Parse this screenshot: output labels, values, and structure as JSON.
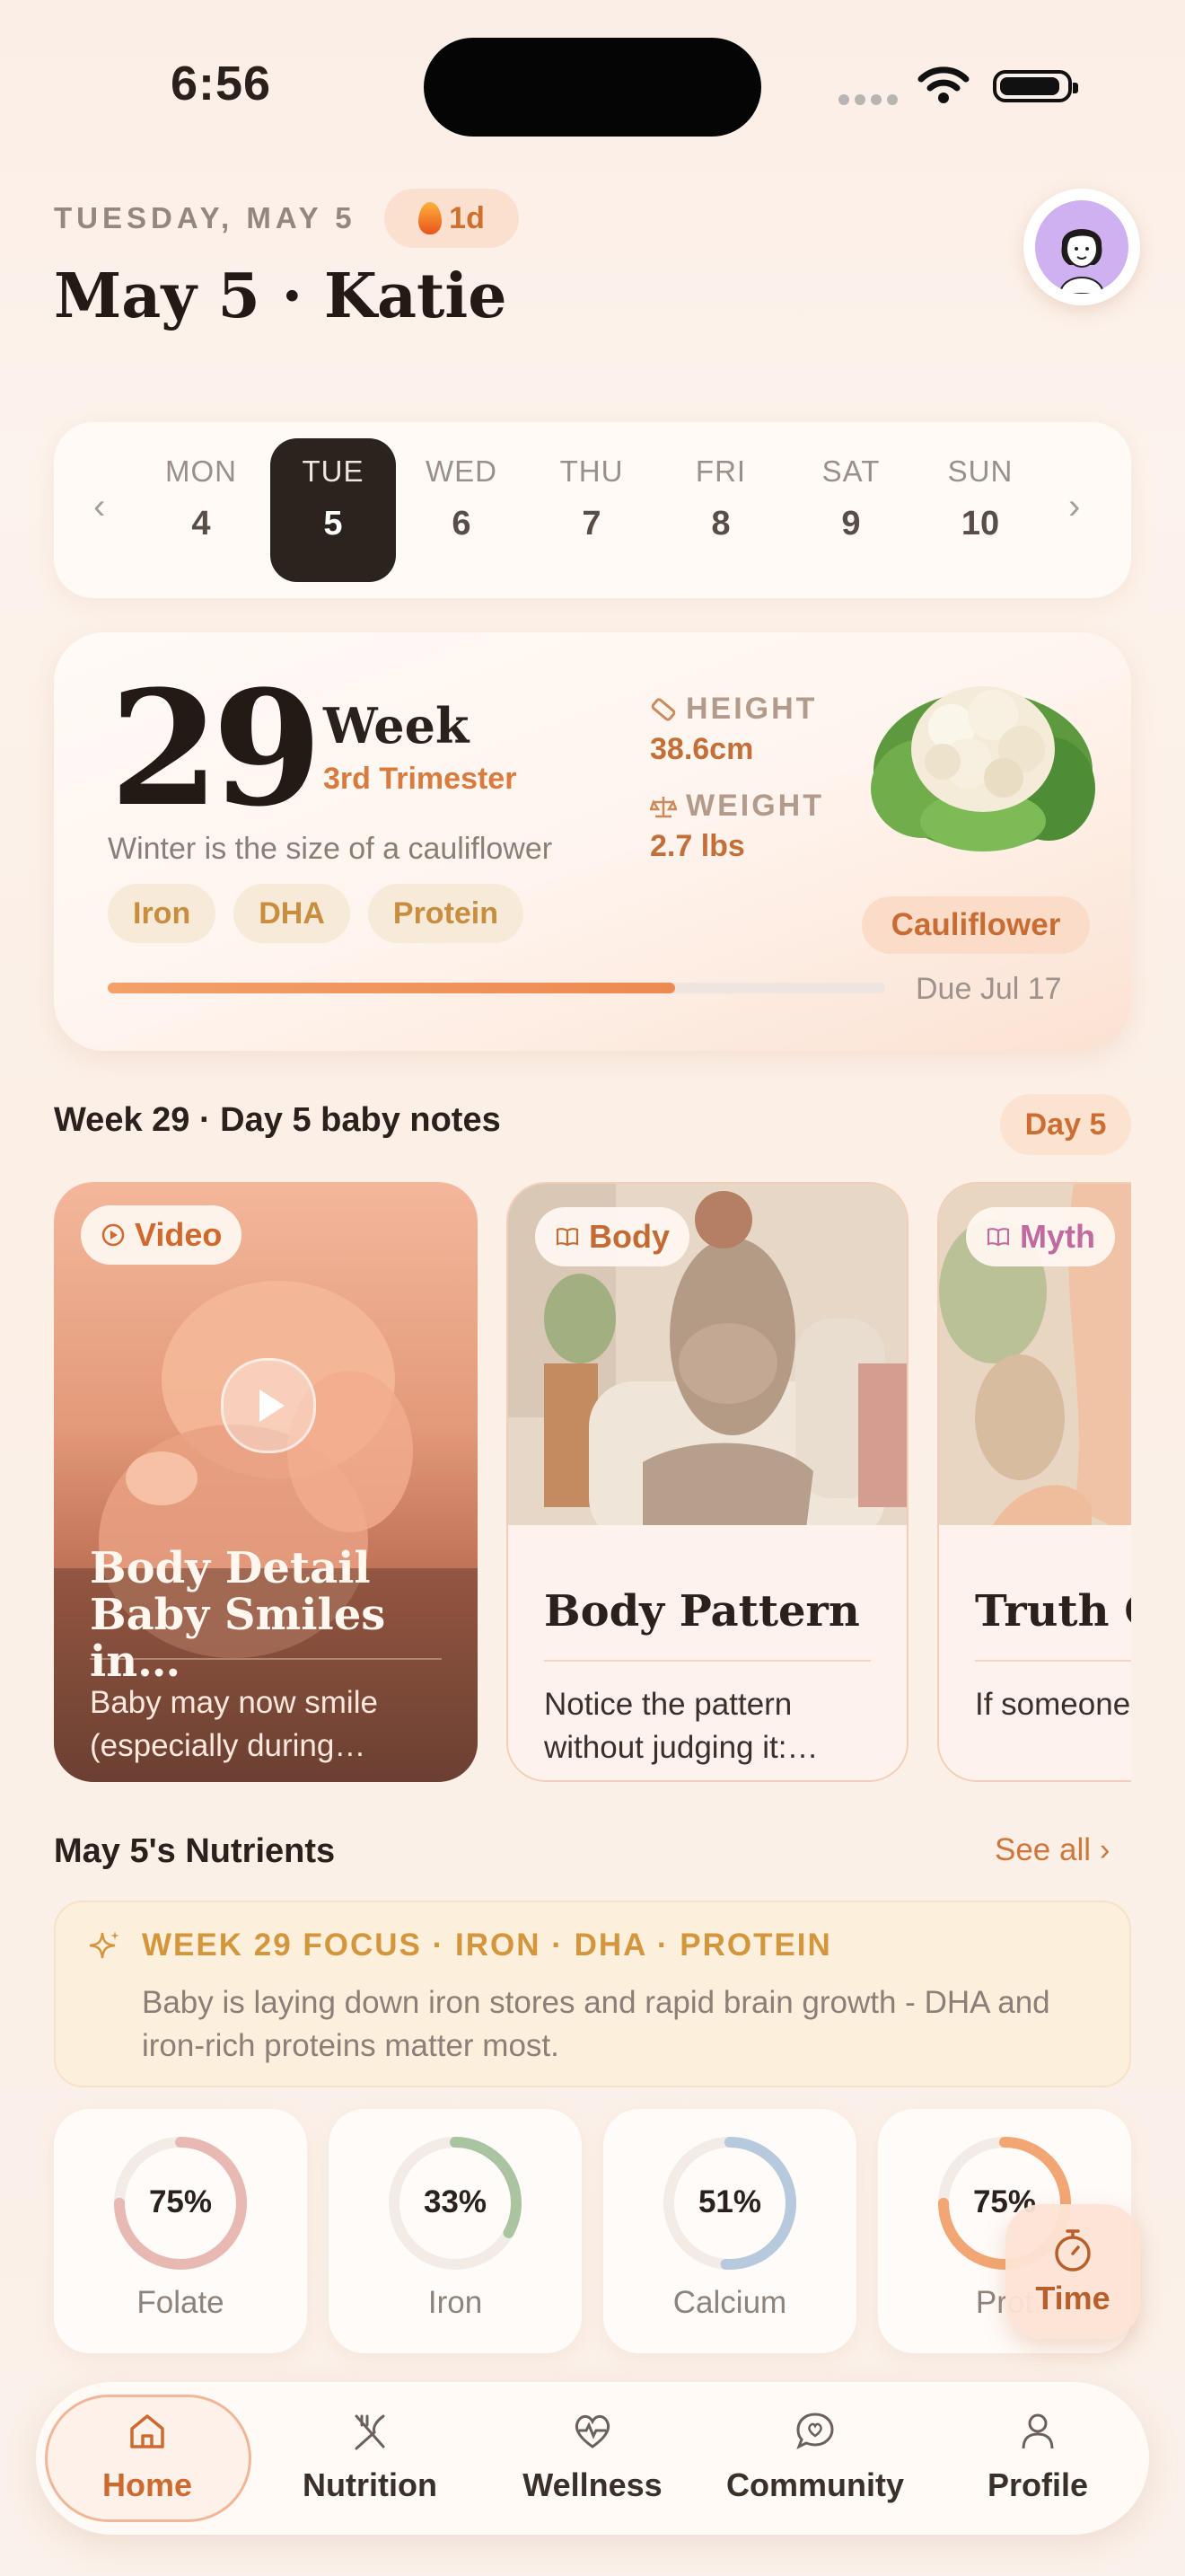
{
  "status_bar": {
    "time": "6:56"
  },
  "header": {
    "date": "TUESDAY, MAY 5",
    "streak": "1d",
    "title": "May 5 · Katie"
  },
  "week_strip": {
    "days": [
      {
        "name": "MON",
        "num": "4"
      },
      {
        "name": "TUE",
        "num": "5",
        "selected": true
      },
      {
        "name": "WED",
        "num": "6"
      },
      {
        "name": "THU",
        "num": "7"
      },
      {
        "name": "FRI",
        "num": "8"
      },
      {
        "name": "SAT",
        "num": "9"
      },
      {
        "name": "SUN",
        "num": "10"
      }
    ]
  },
  "pregnancy": {
    "week_number": "29",
    "week_label": "Week",
    "trimester": "3rd Trimester",
    "size_text": "Winter is the size of a cauliflower",
    "chips": [
      "Iron",
      "DHA",
      "Protein"
    ],
    "height_label": "HEIGHT",
    "height_value": "38.6cm",
    "weight_label": "WEIGHT",
    "weight_value": "2.7 lbs",
    "fruit": "Cauliflower",
    "progress": 0.73,
    "due": "Due Jul 17"
  },
  "baby_notes": {
    "heading": "Week 29 · Day 5 baby notes",
    "day_pill": "Day 5",
    "cards": [
      {
        "tag": "Video",
        "title": "Body Detail Baby Smiles in…",
        "text": "Baby may now smile (especially during…"
      },
      {
        "tag": "Body",
        "title": "Body Pattern",
        "text": "Notice the pattern without judging it:…"
      },
      {
        "tag": "Myth",
        "title": "Truth C",
        "text": "If someone the myth, t"
      }
    ]
  },
  "nutrients": {
    "heading": "May 5's Nutrients",
    "see_all": "See all",
    "focus_title": "WEEK 29 FOCUS · IRON · DHA · PROTEIN",
    "focus_text": "Baby is laying down iron stores and rapid brain growth - DHA and iron-rich proteins matter most.",
    "items": [
      {
        "pct": "75%",
        "label": "Folate",
        "value": 0.75,
        "color": "#e8b8b3"
      },
      {
        "pct": "33%",
        "label": "Iron",
        "value": 0.33,
        "color": "#a9c49f"
      },
      {
        "pct": "51%",
        "label": "Calcium",
        "value": 0.51,
        "color": "#b7c9dd"
      },
      {
        "pct": "75%",
        "label": "Prot",
        "value": 0.75,
        "color": "#f2a673"
      }
    ],
    "timer_label": "Time"
  },
  "tabbar": {
    "tabs": [
      {
        "label": "Home",
        "icon": "home-icon",
        "active": true
      },
      {
        "label": "Nutrition",
        "icon": "utensils-icon"
      },
      {
        "label": "Wellness",
        "icon": "heart-pulse-icon"
      },
      {
        "label": "Community",
        "icon": "chat-heart-icon"
      },
      {
        "label": "Profile",
        "icon": "person-icon"
      }
    ]
  },
  "colors": {
    "accent": "#d1763a",
    "dark": "#2b231e"
  }
}
